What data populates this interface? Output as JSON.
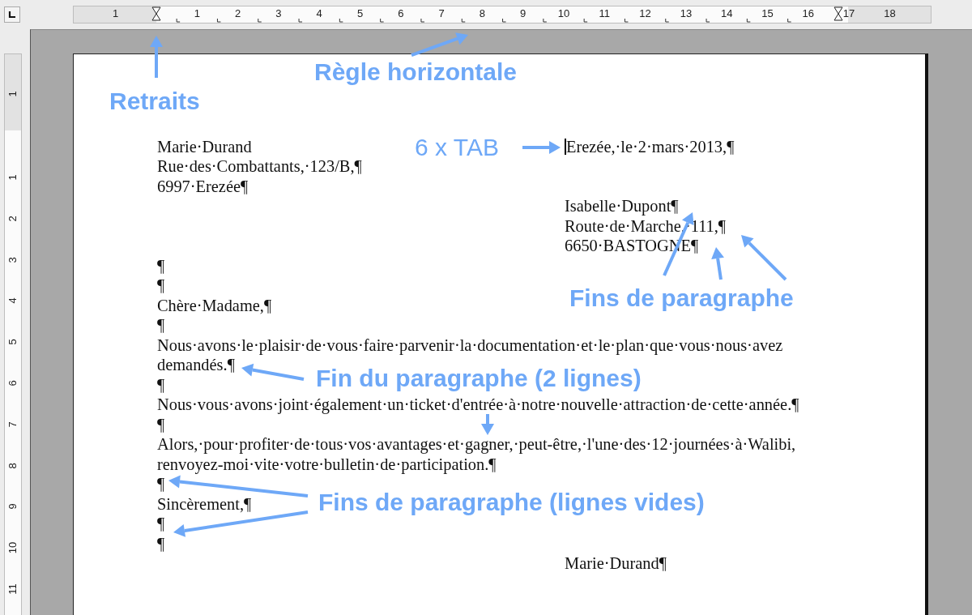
{
  "ruler": {
    "horizontal_labels": [
      "1",
      "1",
      "2",
      "3",
      "4",
      "5",
      "6",
      "7",
      "8",
      "9",
      "10",
      "11",
      "12",
      "13",
      "14",
      "15",
      "16",
      "17",
      "18"
    ],
    "vertical_labels": [
      "1",
      "1",
      "2",
      "3",
      "4",
      "5",
      "6",
      "7",
      "8",
      "9",
      "10",
      "11"
    ]
  },
  "document": {
    "lines": [
      {
        "text": "Marie·Durand",
        "tab_text": "Erezée,·le·2·mars·2013,¶",
        "cursor": true
      },
      {
        "text": "Rue·des·Combattants,·123/B,¶"
      },
      {
        "text": "6997·Erezée¶"
      },
      {
        "tab_text": "Isabelle·Dupont¶"
      },
      {
        "tab_text": "Route·de·Marche,·111,¶"
      },
      {
        "tab_text": "6650·BASTOGNE¶"
      },
      {
        "text": "¶"
      },
      {
        "text": "¶"
      },
      {
        "text": "Chère·Madame,¶"
      },
      {
        "text": "¶"
      },
      {
        "text": "Nous·avons·le·plaisir·de·vous·faire·parvenir·la·documentation·et·le·plan·que·vous·nous·avez"
      },
      {
        "text": "demandés.¶"
      },
      {
        "text": "¶"
      },
      {
        "text": "Nous·vous·avons·joint·également·un·ticket·d'entrée·à·notre·nouvelle·attraction·de·cette·année.¶"
      },
      {
        "text": "¶"
      },
      {
        "text": "Alors,·pour·profiter·de·tous·vos·avantages·et·gagner,·peut-être,·l'une·des·12·journées·à·Walibi,"
      },
      {
        "text": "renvoyez-moi·vite·votre·bulletin·de·participation.¶"
      },
      {
        "text": "¶"
      },
      {
        "text": "Sincèrement,¶"
      },
      {
        "text": "¶"
      },
      {
        "text": "¶"
      },
      {
        "tab_text": "Marie·Durand¶"
      }
    ]
  },
  "annotations": [
    {
      "text": "Retraits",
      "bold": true
    },
    {
      "text": "Règle horizontale",
      "bold": true
    },
    {
      "text": "6 x TAB",
      "bold": false
    },
    {
      "text": "Fins de paragraphe",
      "bold": true
    },
    {
      "text": "Fin du paragraphe (2 lignes)",
      "bold": true
    },
    {
      "text": "Fins de paragraphe (lignes vides)",
      "bold": true
    }
  ]
}
